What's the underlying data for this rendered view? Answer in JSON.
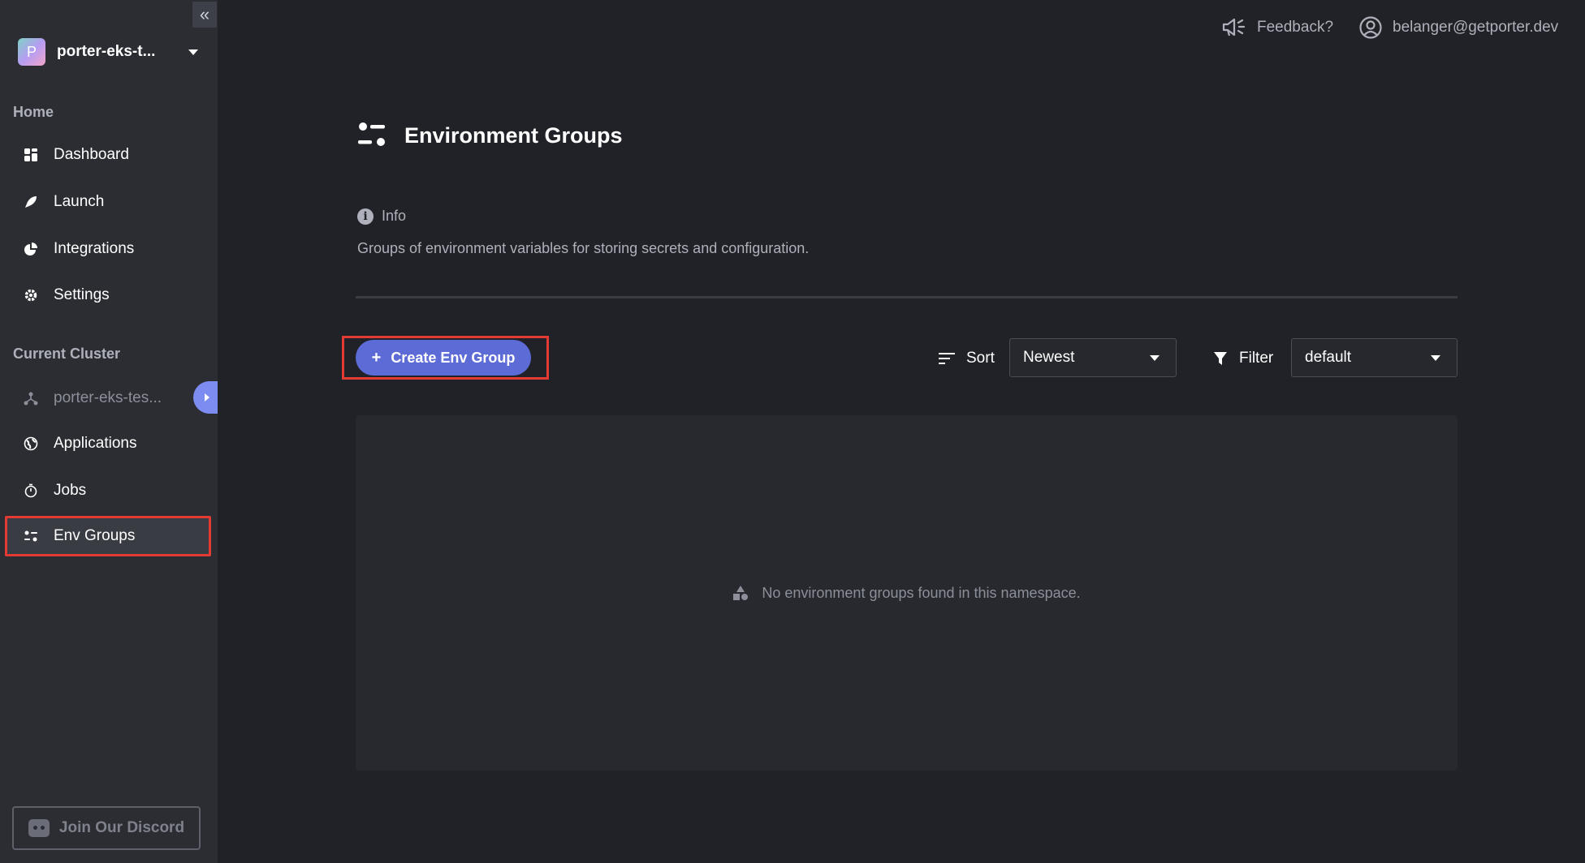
{
  "sidebar": {
    "collapse_glyph": "«",
    "project": {
      "avatar_letter": "P",
      "name": "porter-eks-t..."
    },
    "home_label": "Home",
    "home_items": [
      {
        "label": "Dashboard",
        "icon": "dashboard-icon"
      },
      {
        "label": "Launch",
        "icon": "rocket-icon"
      },
      {
        "label": "Integrations",
        "icon": "pie-chart-icon"
      },
      {
        "label": "Settings",
        "icon": "gear-icon"
      }
    ],
    "cluster_label": "Current Cluster",
    "cluster_name": "porter-eks-tes...",
    "cluster_items": [
      {
        "label": "Applications",
        "icon": "globe-icon"
      },
      {
        "label": "Jobs",
        "icon": "stopwatch-icon"
      },
      {
        "label": "Env Groups",
        "icon": "env-groups-icon",
        "active": true
      }
    ],
    "discord_label": "Join Our Discord"
  },
  "topbar": {
    "feedback_label": "Feedback?",
    "user_email": "belanger@getporter.dev"
  },
  "main": {
    "title": "Environment Groups",
    "info_label": "Info",
    "description": "Groups of environment variables for storing secrets and configuration.",
    "create_button": "Create Env Group",
    "sort_label": "Sort",
    "sort_value": "Newest",
    "filter_label": "Filter",
    "filter_value": "default",
    "empty_message": "No environment groups found in this namespace."
  },
  "colors": {
    "accent": "#5c6bd6",
    "highlight": "#e33b34",
    "background": "#202227",
    "sidebar": "#2b2d33"
  }
}
